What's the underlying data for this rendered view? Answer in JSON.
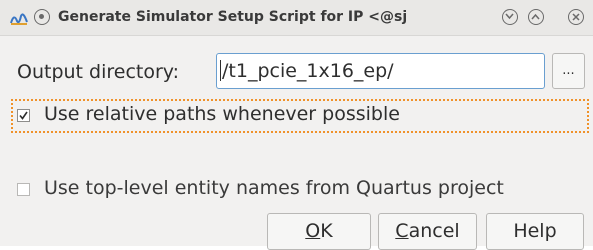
{
  "window": {
    "title": "Generate Simulator Setup Script for IP <@sj",
    "app_icon": "quartus-app-icon",
    "title_buttons": [
      "menu-dot-icon",
      "chevron-down-icon",
      "chevron-up-icon",
      "close-icon"
    ]
  },
  "output_directory": {
    "label": "Output directory:",
    "value": "/t1_pcie_1x16_ep/",
    "browse_label": "..."
  },
  "options": [
    {
      "label": "Use relative paths whenever possible",
      "checked": true,
      "focused": true
    },
    {
      "label": "Use top-level entity names from Quartus project",
      "checked": false,
      "focused": false
    }
  ],
  "buttons": {
    "ok": {
      "mnemonic": "O",
      "rest": "K"
    },
    "cancel": {
      "mnemonic": "C",
      "rest": "ancel"
    },
    "help": "Help"
  },
  "colors": {
    "focus_ring": "#f0922a",
    "input_border": "#6a9fd0",
    "background": "#f2f1f0"
  }
}
